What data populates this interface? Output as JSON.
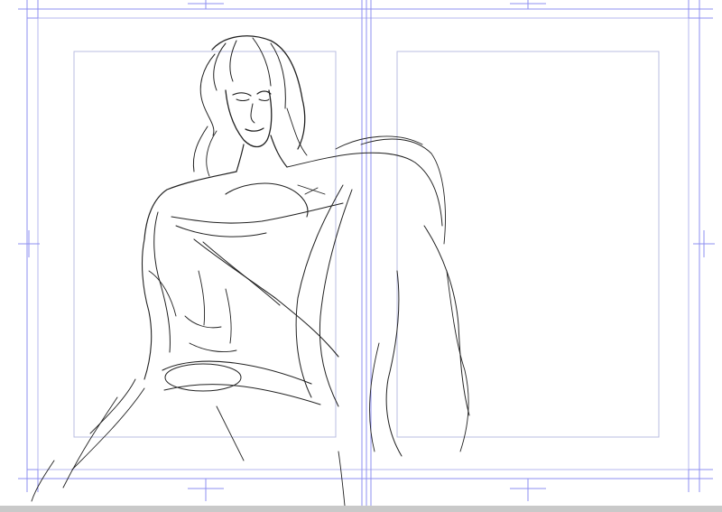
{
  "app": {
    "window_type": "manga-spread-canvas",
    "colors": {
      "canvas_bg": "#ffffff",
      "guide_line": "#8d8ff0",
      "panel_border": "#b9bce0",
      "sketch_stroke": "#222222",
      "statusbar_bg": "#c9c9c9"
    }
  },
  "canvas": {
    "pages": [
      "left-page",
      "right-page"
    ],
    "has_crop_marks": true,
    "has_inner_frames": true,
    "content": "pencil-sketch-figure"
  }
}
